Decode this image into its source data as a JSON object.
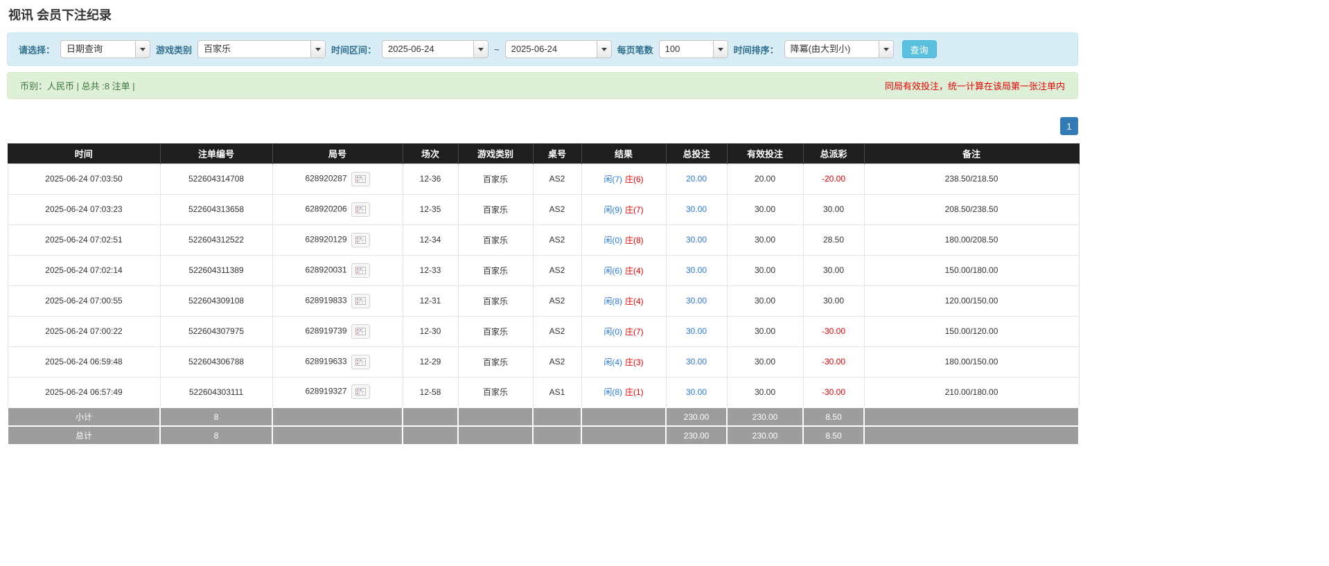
{
  "page": {
    "title": "视讯 会员下注纪录"
  },
  "filters": {
    "select_label": "请选择：",
    "select_value": "日期查询",
    "game_type_label": "游戏类别",
    "game_type_value": "百家乐",
    "date_range_label": "时间区间：",
    "date_from": "2025-06-24",
    "date_separator": "~",
    "date_to": "2025-06-24",
    "page_size_label": "每页笔数",
    "page_size_value": "100",
    "sort_label": "时间排序：",
    "sort_value": "降冪(由大到小)",
    "search_button": "查询"
  },
  "summary": {
    "left": "币别：人民币 | 总共 :8 注单 |",
    "right": "同局有效投注，统一计算在该局第一张注单内"
  },
  "pagination": {
    "pages": [
      "1"
    ]
  },
  "table": {
    "headers": [
      "时间",
      "注单编号",
      "局号",
      "场次",
      "游戏类别",
      "桌号",
      "结果",
      "总投注",
      "有效投注",
      "总派彩",
      "备注"
    ],
    "rows": [
      {
        "time": "2025-06-24 07:03:50",
        "bet_id": "522604314708",
        "round_id": "628920287",
        "session": "12-36",
        "game": "百家乐",
        "table_no": "AS2",
        "result_player": "闲(7)",
        "result_banker": "庄(6)",
        "total_bet": "20.00",
        "valid_bet": "20.00",
        "payout": "-20.00",
        "remark": "238.50/218.50"
      },
      {
        "time": "2025-06-24 07:03:23",
        "bet_id": "522604313658",
        "round_id": "628920206",
        "session": "12-35",
        "game": "百家乐",
        "table_no": "AS2",
        "result_player": "闲(9)",
        "result_banker": "庄(7)",
        "total_bet": "30.00",
        "valid_bet": "30.00",
        "payout": "30.00",
        "remark": "208.50/238.50"
      },
      {
        "time": "2025-06-24 07:02:51",
        "bet_id": "522604312522",
        "round_id": "628920129",
        "session": "12-34",
        "game": "百家乐",
        "table_no": "AS2",
        "result_player": "闲(0)",
        "result_banker": "庄(8)",
        "total_bet": "30.00",
        "valid_bet": "30.00",
        "payout": "28.50",
        "remark": "180.00/208.50"
      },
      {
        "time": "2025-06-24 07:02:14",
        "bet_id": "522604311389",
        "round_id": "628920031",
        "session": "12-33",
        "game": "百家乐",
        "table_no": "AS2",
        "result_player": "闲(6)",
        "result_banker": "庄(4)",
        "total_bet": "30.00",
        "valid_bet": "30.00",
        "payout": "30.00",
        "remark": "150.00/180.00"
      },
      {
        "time": "2025-06-24 07:00:55",
        "bet_id": "522604309108",
        "round_id": "628919833",
        "session": "12-31",
        "game": "百家乐",
        "table_no": "AS2",
        "result_player": "闲(8)",
        "result_banker": "庄(4)",
        "total_bet": "30.00",
        "valid_bet": "30.00",
        "payout": "30.00",
        "remark": "120.00/150.00"
      },
      {
        "time": "2025-06-24 07:00:22",
        "bet_id": "522604307975",
        "round_id": "628919739",
        "session": "12-30",
        "game": "百家乐",
        "table_no": "AS2",
        "result_player": "闲(0)",
        "result_banker": "庄(7)",
        "total_bet": "30.00",
        "valid_bet": "30.00",
        "payout": "-30.00",
        "remark": "150.00/120.00"
      },
      {
        "time": "2025-06-24 06:59:48",
        "bet_id": "522604306788",
        "round_id": "628919633",
        "session": "12-29",
        "game": "百家乐",
        "table_no": "AS2",
        "result_player": "闲(4)",
        "result_banker": "庄(3)",
        "total_bet": "30.00",
        "valid_bet": "30.00",
        "payout": "-30.00",
        "remark": "180.00/150.00"
      },
      {
        "time": "2025-06-24 06:57:49",
        "bet_id": "522604303111",
        "round_id": "628919327",
        "session": "12-58",
        "game": "百家乐",
        "table_no": "AS1",
        "result_player": "闲(8)",
        "result_banker": "庄(1)",
        "total_bet": "30.00",
        "valid_bet": "30.00",
        "payout": "-30.00",
        "remark": "210.00/180.00"
      }
    ],
    "subtotal": {
      "label": "小计",
      "count": "8",
      "total_bet": "230.00",
      "valid_bet": "230.00",
      "payout": "8.50"
    },
    "total": {
      "label": "总计",
      "count": "8",
      "total_bet": "230.00",
      "valid_bet": "230.00",
      "payout": "8.50"
    }
  },
  "colors": {
    "player_blue": "#2a7ae2",
    "banker_red": "#e60000",
    "negative_red": "#e60000",
    "link_blue": "#2a7ae2",
    "table_header_bg": "#1e1e1e",
    "table_footer_bg": "#9d9d9d",
    "filter_bar_bg": "#d9edf7",
    "summary_bar_bg": "#dff0d8",
    "summary_text_green": "#3c763d",
    "notice_red": "#e60000",
    "search_button_bg": "#5bc0de",
    "pagination_bg": "#337ab7"
  }
}
